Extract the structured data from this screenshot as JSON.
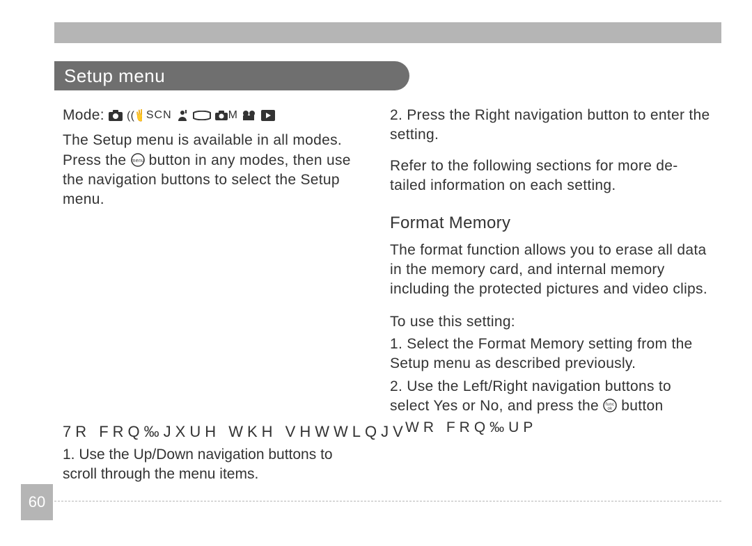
{
  "page_number": "60",
  "section_title": "Setup menu",
  "mode_label": "Mode:",
  "mode_icons": [
    "camera-icon",
    "anti-shake-icon",
    "scn-label",
    "portrait-icon",
    "panorama-icon",
    "camera-m-icon",
    "movie-icon",
    "play-icon"
  ],
  "mode_scn_text": "SCN",
  "mode_m_text": "M",
  "left": {
    "intro_1a": "The ",
    "intro_1b": "Setup",
    "intro_1c": "  menu is available in all modes. Press the ",
    "intro_1d": " button in any modes, then use the navigation buttons to select the ",
    "intro_1e": "Setup",
    "intro_1f": "  menu.",
    "config_heading": "7R FRQ‰JXUH WKH VHWWLQJV",
    "step1_a": "1. Use the ",
    "step1_b": "Up/Down",
    "step1_c": "  navigation buttons to scroll through the menu items."
  },
  "right": {
    "step2_a": "2. Press the ",
    "step2_b": "Right",
    "step2_c": "  navigation button to enter the setting.",
    "refer": "Refer to the following sections for more de-tailed information on each setting.",
    "h2": "Format Memory",
    "fm_desc": "The format function allows you to erase all data in the memory card, and internal memory including the protected pictures and video clips.",
    "fm_to_use": "To use this setting:",
    "fm_s1_a": "1. Select the ",
    "fm_s1_b": "Format",
    "fm_s1_c": "  Memory  setting from the ",
    "fm_s1_d": "Setup",
    "fm_s1_e": "  menu as described previously.",
    "fm_s2_a": "2. Use the ",
    "fm_s2_b": "Left/Right",
    "fm_s2_c": "  navigation buttons to select ",
    "fm_s2_d": "Yes",
    "fm_s2_e": " or ",
    "fm_s2_f": "No",
    "fm_s2_g": ", and press the ",
    "fm_s2_h": " button",
    "wr_line": "WR FRQ‰UP"
  }
}
